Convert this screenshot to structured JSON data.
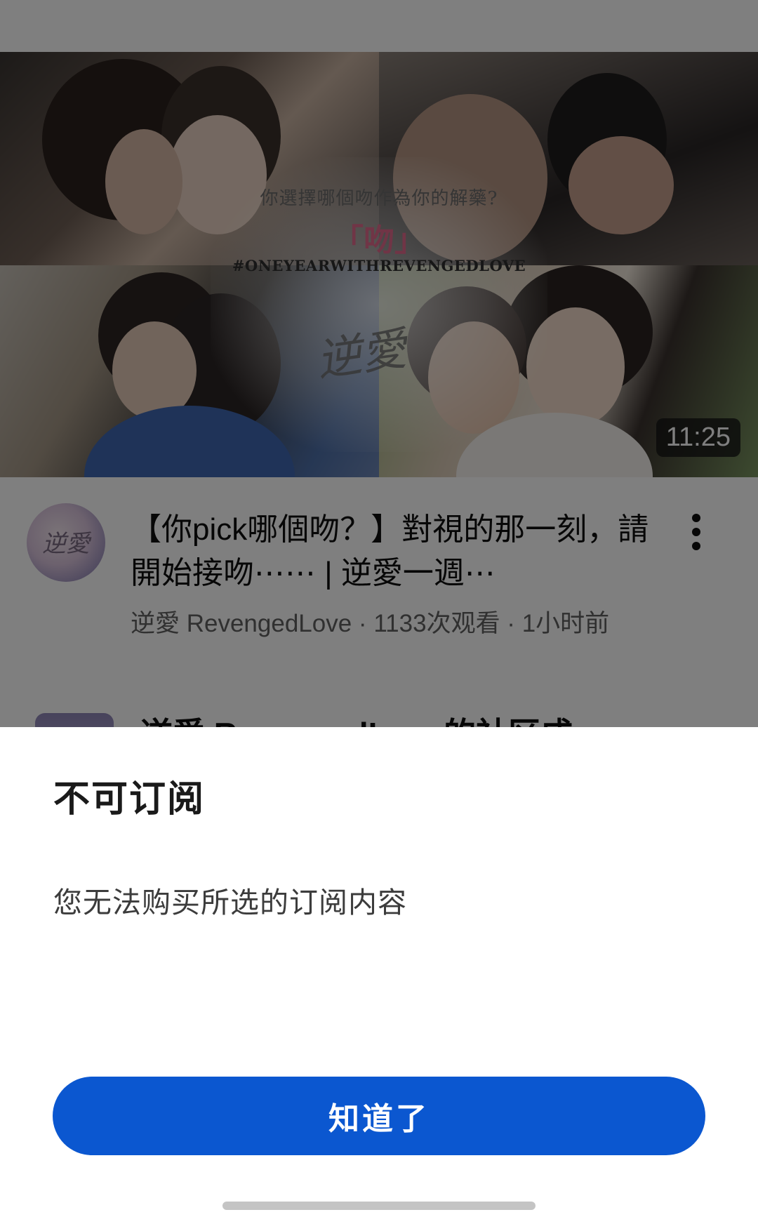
{
  "video": {
    "thumbnail": {
      "question_text": "你選擇哪個吻作為你的解藥?",
      "kiss_text": "「吻」",
      "hashtag": "#ONEYEARWITHREVENGEDLOVE",
      "logo_text": "逆愛",
      "duration": "11:25"
    },
    "title": "【你pick哪個吻？】對視的那一刻，請開始接吻⋯⋯ | 逆愛一週⋯",
    "channel": "逆愛 RevengedLove",
    "views": "1133次观看",
    "age": "1小时前",
    "separator": " · ",
    "avatar_text": "逆愛",
    "more_icon": "more-vertical-icon"
  },
  "next_item": {
    "title": "逆愛 RevengedLove的社区成"
  },
  "dialog": {
    "title": "不可订阅",
    "message": "您无法购买所选的订阅内容",
    "confirm_label": "知道了",
    "button_color": "#0b57d0"
  },
  "colors": {
    "scrim": "rgba(0,0,0,0.5)",
    "title_text": "#0f0f0f",
    "meta_text": "#606060"
  }
}
